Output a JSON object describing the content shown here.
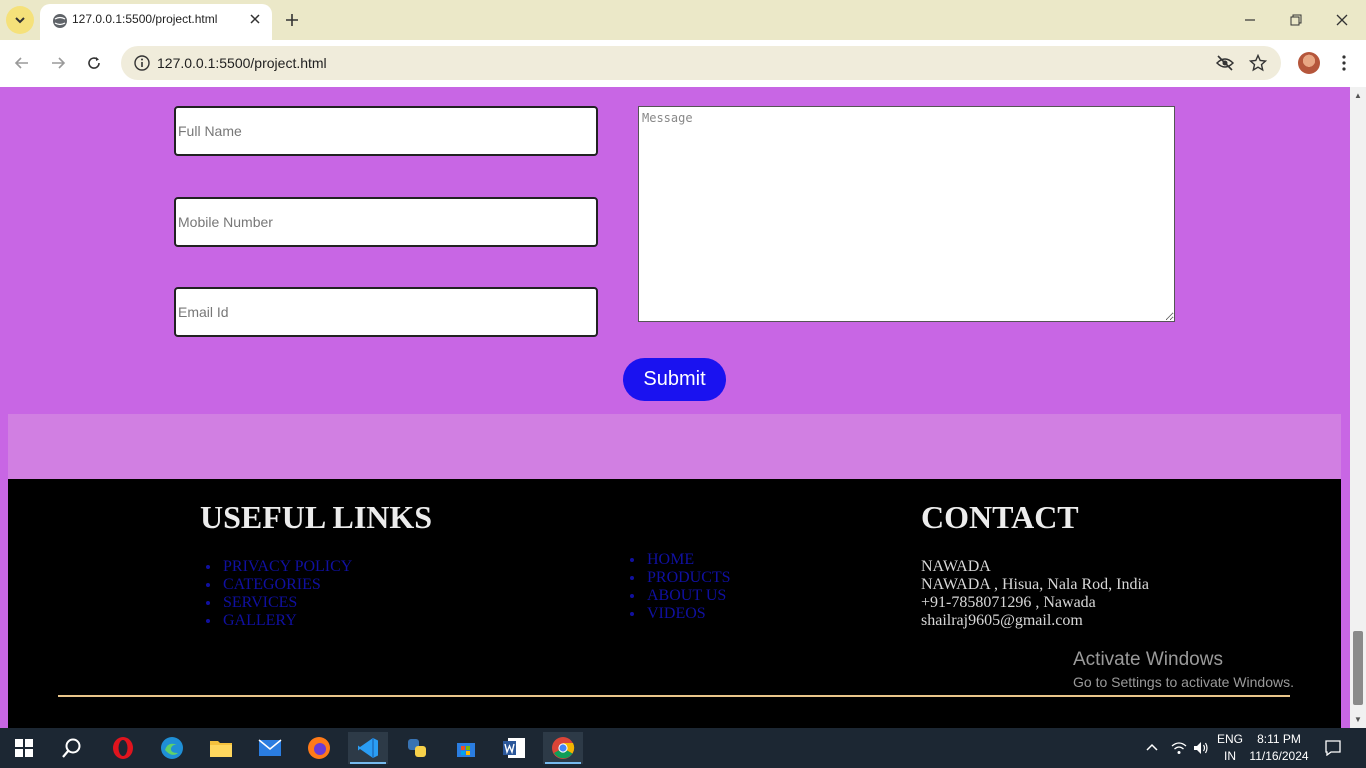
{
  "browser": {
    "tab_title": "127.0.0.1:5500/project.html",
    "url": "127.0.0.1:5500/project.html"
  },
  "form": {
    "full_name_placeholder": "Full Name",
    "mobile_placeholder": "Mobile Number",
    "email_placeholder": "Email Id",
    "message_placeholder": "Message",
    "submit_label": "Submit"
  },
  "footer": {
    "useful_links_heading": "USEFUL LINKS",
    "links_left": [
      "PRIVACY POLICY",
      "CATEGORIES",
      "SERVICES",
      "GALLERY"
    ],
    "links_middle": [
      "HOME",
      "PRODUCTS",
      "ABOUT US",
      "VIDEOS"
    ],
    "contact_heading": "CONTACT",
    "contact_lines": [
      "NAWADA",
      "NAWADA , Hisua, Nala Rod, India",
      "+91-7858071296 , Nawada",
      "shailraj9605@gmail.com"
    ]
  },
  "watermark": {
    "line1": "Activate Windows",
    "line2": "Go to Settings to activate Windows."
  },
  "taskbar": {
    "lang_top": "ENG",
    "lang_bottom": "IN",
    "time": "8:11 PM",
    "date": "11/16/2024"
  },
  "colors": {
    "page_bg": "#c866e4",
    "band_bg": "#d17fe2",
    "submit_bg": "#1a12f0",
    "footer_bg": "#000000",
    "link_color": "#1010a0",
    "rule_color": "#e8c58a"
  }
}
